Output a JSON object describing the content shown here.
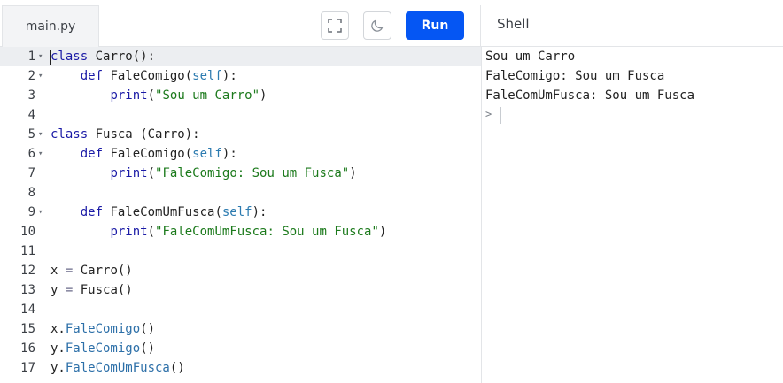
{
  "tabs": {
    "file_tab": "main.py",
    "shell_title": "Shell"
  },
  "toolbar": {
    "run_label": "Run",
    "fullscreen_icon": "fullscreen-icon",
    "theme_icon": "moon-icon"
  },
  "editor": {
    "active_line": 1,
    "lines": [
      {
        "n": "1",
        "fold": true,
        "text": "class Carro():"
      },
      {
        "n": "2",
        "fold": true,
        "text": "    def FaleComigo(self):"
      },
      {
        "n": "3",
        "fold": false,
        "text": "        print(\"Sou um Carro\")"
      },
      {
        "n": "4",
        "fold": false,
        "text": ""
      },
      {
        "n": "5",
        "fold": true,
        "text": "class Fusca (Carro):"
      },
      {
        "n": "6",
        "fold": true,
        "text": "    def FaleComigo(self):"
      },
      {
        "n": "7",
        "fold": false,
        "text": "        print(\"FaleComigo: Sou um Fusca\")"
      },
      {
        "n": "8",
        "fold": false,
        "text": ""
      },
      {
        "n": "9",
        "fold": true,
        "text": "    def FaleComUmFusca(self):"
      },
      {
        "n": "10",
        "fold": false,
        "text": "        print(\"FaleComUmFusca: Sou um Fusca\")"
      },
      {
        "n": "11",
        "fold": false,
        "text": ""
      },
      {
        "n": "12",
        "fold": false,
        "text": "x = Carro()"
      },
      {
        "n": "13",
        "fold": false,
        "text": "y = Fusca()"
      },
      {
        "n": "14",
        "fold": false,
        "text": ""
      },
      {
        "n": "15",
        "fold": false,
        "text": "x.FaleComigo()"
      },
      {
        "n": "16",
        "fold": false,
        "text": "y.FaleComigo()"
      },
      {
        "n": "17",
        "fold": false,
        "text": "y.FaleComUmFusca()"
      }
    ]
  },
  "shell": {
    "output": [
      "Sou um Carro",
      "FaleComigo: Sou um Fusca",
      "FaleComUmFusca: Sou um Fusca"
    ],
    "prompt": ">"
  },
  "colors": {
    "run_button": "#0556f3",
    "active_line_bg": "#eceef1",
    "keyword": "#1a1aa6",
    "string": "#1c7a1c"
  }
}
